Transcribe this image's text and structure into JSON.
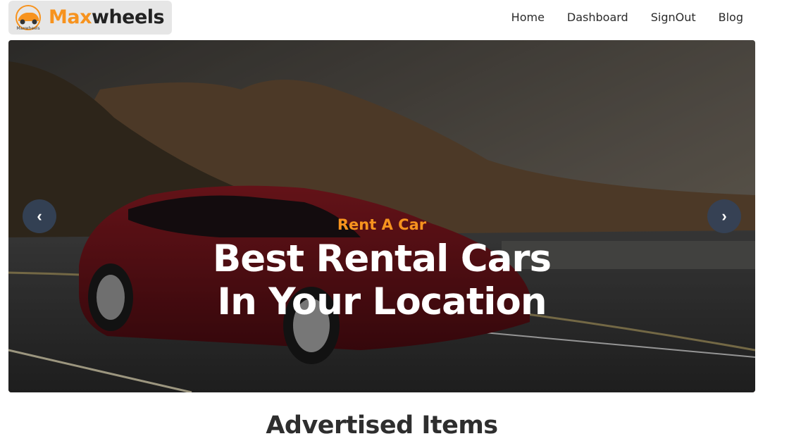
{
  "brand": {
    "name_part1": "Max",
    "name_part2": "wheels",
    "badge_text": "Maxwheels",
    "accent_color": "#f7931e"
  },
  "nav": {
    "items": [
      {
        "label": "Home"
      },
      {
        "label": "Dashboard"
      },
      {
        "label": "SignOut"
      },
      {
        "label": "Blog"
      }
    ]
  },
  "hero": {
    "eyebrow": "Rent A Car",
    "headline_line1": "Best Rental Cars",
    "headline_line2": "In Your Location",
    "prev_icon": "‹",
    "next_icon": "›",
    "image_description_icon": "car-photo"
  },
  "section": {
    "title": "Advertised Items"
  }
}
